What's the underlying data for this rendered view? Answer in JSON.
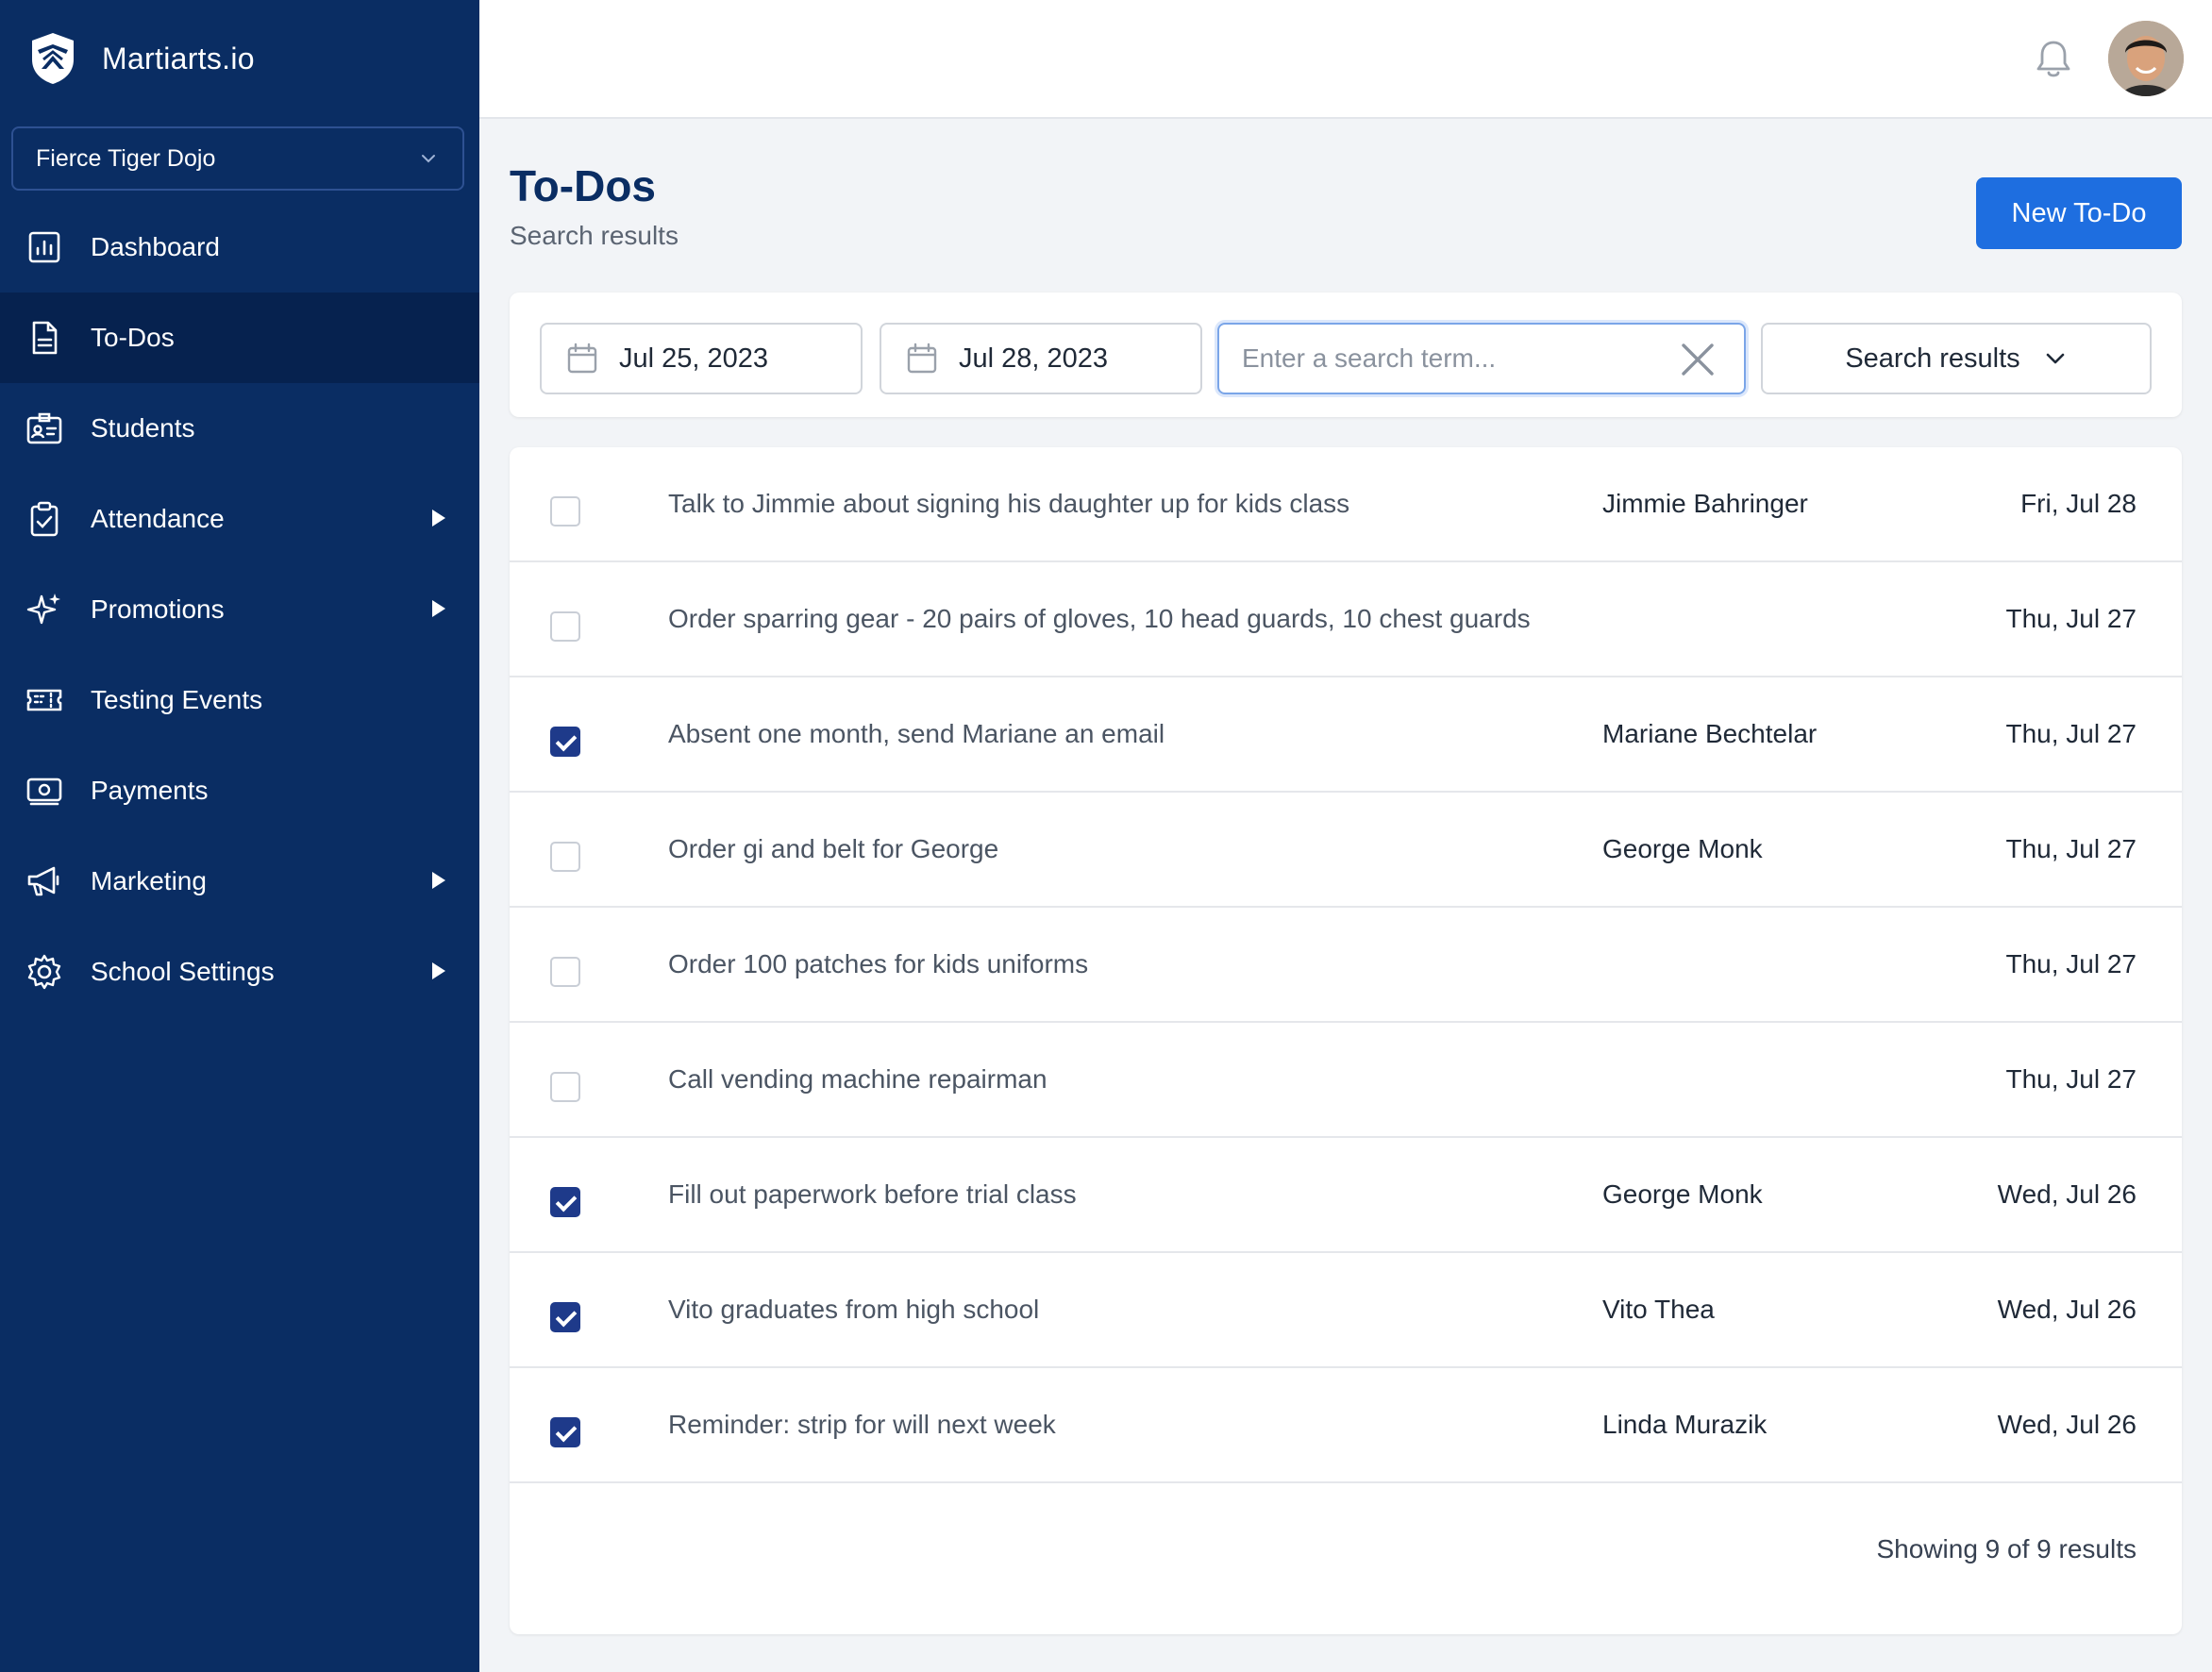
{
  "brand": {
    "name": "Martiarts.io"
  },
  "school_selector": {
    "value": "Fierce Tiger Dojo"
  },
  "nav": [
    {
      "label": "Dashboard",
      "icon": "chart-icon",
      "active": false,
      "has_submenu": false
    },
    {
      "label": "To-Dos",
      "icon": "document-icon",
      "active": true,
      "has_submenu": false
    },
    {
      "label": "Students",
      "icon": "id-card-icon",
      "active": false,
      "has_submenu": false
    },
    {
      "label": "Attendance",
      "icon": "clipboard-check-icon",
      "active": false,
      "has_submenu": true
    },
    {
      "label": "Promotions",
      "icon": "sparkles-icon",
      "active": false,
      "has_submenu": true
    },
    {
      "label": "Testing Events",
      "icon": "ticket-icon",
      "active": false,
      "has_submenu": false
    },
    {
      "label": "Payments",
      "icon": "cash-icon",
      "active": false,
      "has_submenu": false
    },
    {
      "label": "Marketing",
      "icon": "megaphone-icon",
      "active": false,
      "has_submenu": true
    },
    {
      "label": "School Settings",
      "icon": "gear-icon",
      "active": false,
      "has_submenu": true
    }
  ],
  "header": {
    "title": "To-Dos",
    "subtitle": "Search results",
    "new_button": "New To-Do"
  },
  "filters": {
    "start_date": "Jul 25, 2023",
    "end_date": "Jul 28, 2023",
    "search_placeholder": "Enter a search term...",
    "search_value": "",
    "results_dropdown": "Search results"
  },
  "todos": [
    {
      "done": false,
      "task": "Talk to Jimmie about signing his daughter up for kids class",
      "person": "Jimmie Bahringer",
      "date": "Fri, Jul 28"
    },
    {
      "done": false,
      "task": "Order sparring gear - 20 pairs of gloves, 10 head guards, 10 chest guards",
      "person": "",
      "date": "Thu, Jul 27"
    },
    {
      "done": true,
      "task": "Absent one month, send Mariane an email",
      "person": "Mariane Bechtelar",
      "date": "Thu, Jul 27"
    },
    {
      "done": false,
      "task": "Order gi and belt for George",
      "person": "George Monk",
      "date": "Thu, Jul 27"
    },
    {
      "done": false,
      "task": "Order 100 patches for kids uniforms",
      "person": "",
      "date": "Thu, Jul 27"
    },
    {
      "done": false,
      "task": "Call vending machine repairman",
      "person": "",
      "date": "Thu, Jul 27"
    },
    {
      "done": true,
      "task": "Fill out paperwork before trial class",
      "person": "George Monk",
      "date": "Wed, Jul 26"
    },
    {
      "done": true,
      "task": "Vito graduates from high school",
      "person": "Vito Thea",
      "date": "Wed, Jul 26"
    },
    {
      "done": true,
      "task": "Reminder: strip for will next week",
      "person": "Linda Murazik",
      "date": "Wed, Jul 26"
    }
  ],
  "footer": {
    "showing": "Showing 9 of 9 results"
  },
  "colors": {
    "sidebar": "#0a2d63",
    "sidebar_active": "#06224f",
    "primary": "#1e6ee0",
    "checkbox_checked": "#1e3a8a"
  }
}
